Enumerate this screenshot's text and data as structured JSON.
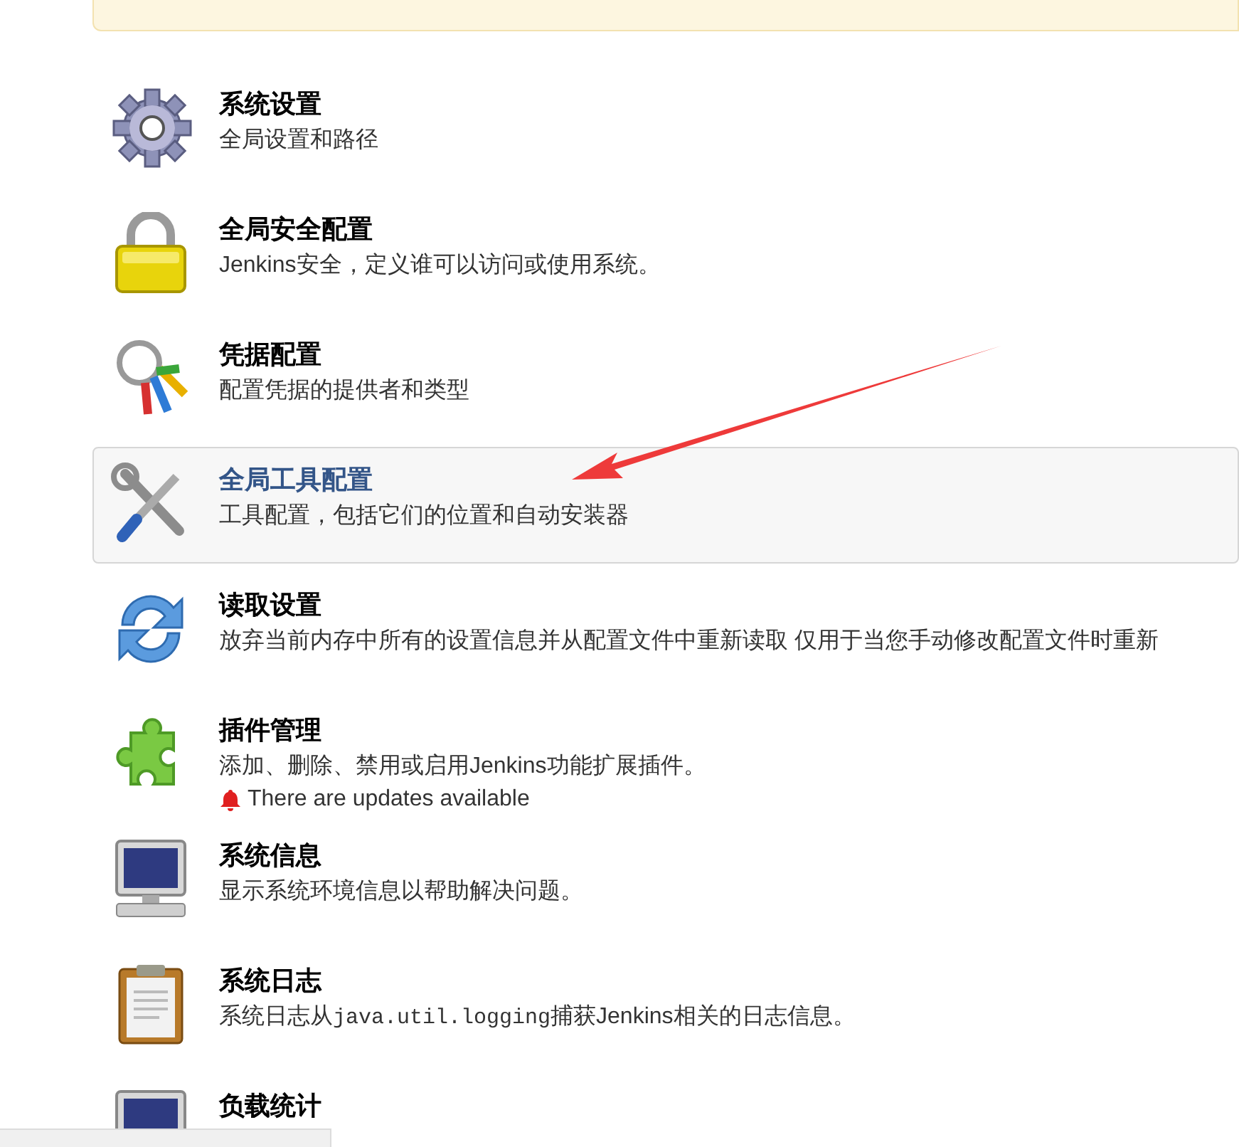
{
  "items": [
    {
      "kind": "gear",
      "title": "系统设置",
      "selected": false,
      "description": [
        {
          "kind": "text",
          "text": "全局设置和路径"
        }
      ]
    },
    {
      "kind": "lock",
      "title": "全局安全配置",
      "selected": false,
      "description": [
        {
          "kind": "text",
          "text": "Jenkins安全，定义谁可以访问或使用系统。"
        }
      ]
    },
    {
      "kind": "keys",
      "title": "凭据配置",
      "selected": false,
      "description": [
        {
          "kind": "text",
          "text": "配置凭据的提供者和类型"
        }
      ]
    },
    {
      "kind": "tools",
      "title": "全局工具配置",
      "selected": true,
      "description": [
        {
          "kind": "text",
          "text": "工具配置，包括它们的位置和自动安装器"
        }
      ]
    },
    {
      "kind": "reload",
      "title": "读取设置",
      "selected": false,
      "description": [
        {
          "kind": "text",
          "text": "放弃当前内存中所有的设置信息并从配置文件中重新读取 仅用于当您手动修改配置文件时重新"
        }
      ]
    },
    {
      "kind": "puzzle",
      "title": "插件管理",
      "selected": false,
      "description": [
        {
          "kind": "text",
          "text": "添加、删除、禁用或启用Jenkins功能扩展插件。"
        }
      ],
      "notice": "There are updates available"
    },
    {
      "kind": "monitor",
      "title": "系统信息",
      "selected": false,
      "description": [
        {
          "kind": "text",
          "text": "显示系统环境信息以帮助解决问题。"
        }
      ]
    },
    {
      "kind": "clipboard",
      "title": "系统日志",
      "selected": false,
      "description": [
        {
          "kind": "text",
          "text": "系统日志从"
        },
        {
          "kind": "code",
          "text": "java.util.logging"
        },
        {
          "kind": "text",
          "text": "捕获Jenkins相关的日志信息。"
        }
      ]
    },
    {
      "kind": "monitor",
      "title": "负载统计",
      "selected": false
    }
  ]
}
